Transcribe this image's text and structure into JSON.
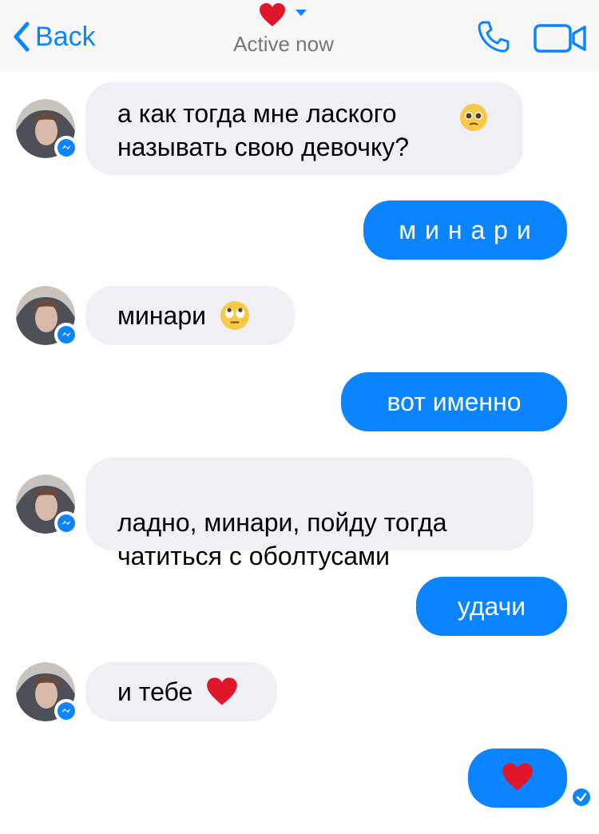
{
  "header": {
    "back_label": "Back",
    "status": "Active now",
    "accent_color": "#0a84ff",
    "icons": [
      "chevron-left-icon",
      "heart-icon",
      "caret-down-icon",
      "phone-icon",
      "video-icon"
    ]
  },
  "messages": [
    {
      "side": "incoming",
      "text": "а как тогда мне лаского\nназывать свою девочку?",
      "emoji": "pleading-face-emoji"
    },
    {
      "side": "outgoing",
      "text": "м и н а р и"
    },
    {
      "side": "incoming",
      "text": "минари",
      "emoji": "eye-roll-emoji"
    },
    {
      "side": "outgoing",
      "text": "вот именно"
    },
    {
      "side": "incoming",
      "text": "ладно, минари, пойду тогда\nчатиться с оболтусами"
    },
    {
      "side": "outgoing",
      "text": "удачи"
    },
    {
      "side": "incoming",
      "text": "и тебе",
      "emoji": "red-heart-emoji"
    },
    {
      "side": "outgoing",
      "text": "",
      "emoji": "red-heart-emoji"
    }
  ],
  "colors": {
    "outgoing_bubble": "#0a84ff",
    "incoming_bubble": "#f0eff4",
    "header_bg": "#f7f7f7",
    "heart": "#e0162b"
  }
}
